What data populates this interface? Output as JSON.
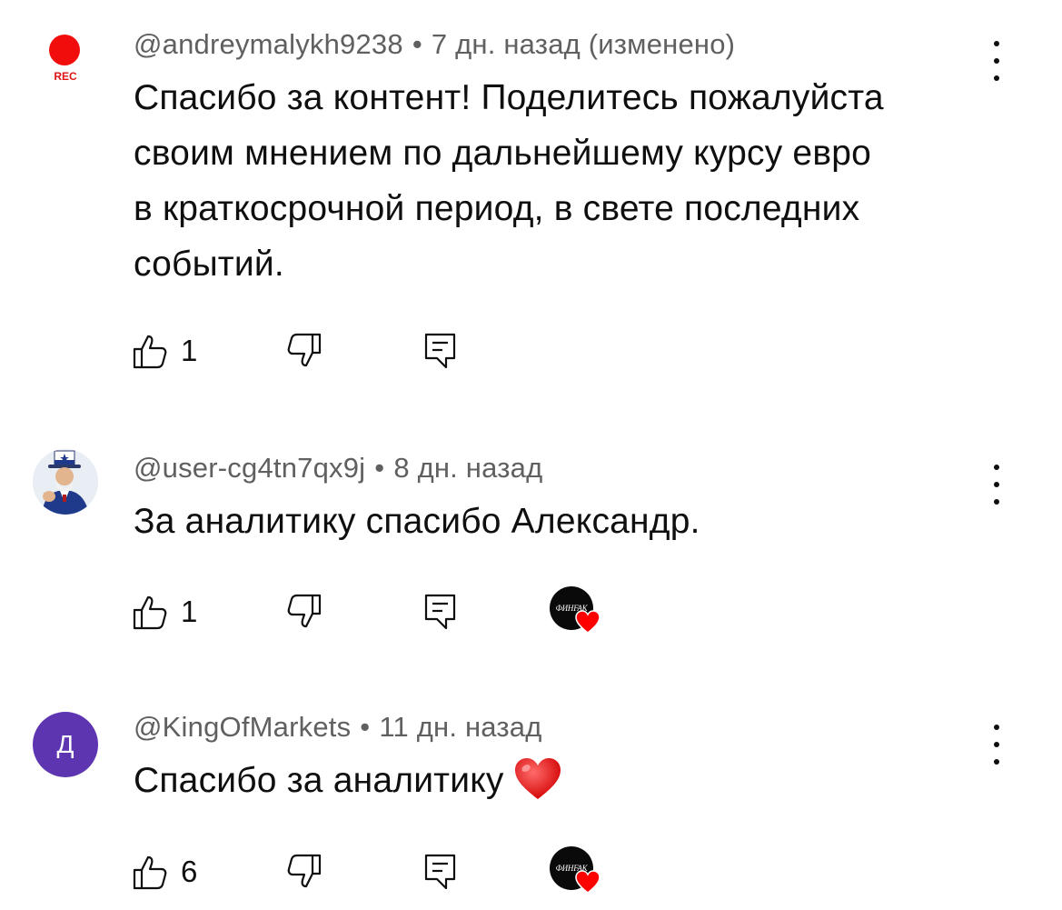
{
  "comments": [
    {
      "author": "@andreymalykh9238",
      "time": "7 дн. назад (изменено)",
      "avatar": {
        "type": "rec",
        "label": "REC",
        "color": "#f20d0d"
      },
      "text_lines": [
        "Спасибо за контент! Поделитесь пожалуйста",
        "своим мнением по дальнейшему курсу евро",
        "в краткосрочной период, в свете последних",
        "событий."
      ],
      "likes": "1",
      "creator_hearted": false
    },
    {
      "author": "@user-cg4tn7qx9j",
      "time": "8 дн. назад",
      "avatar": {
        "type": "image",
        "icon": "uncle-sam-avatar"
      },
      "text_lines": [
        "За аналитику спасибо Александр."
      ],
      "likes": "1",
      "creator_hearted": true
    },
    {
      "author": "@KingOfMarkets",
      "time": "11 дн. назад",
      "avatar": {
        "type": "letter",
        "letter": "Д",
        "color": "#5e35b1"
      },
      "text_lines": [
        "Спасибо за аналитику"
      ],
      "text_emoji": "red-heart-emoji",
      "likes": "6",
      "creator_hearted": true
    }
  ],
  "creator": {
    "label": "ФИНFAK",
    "heart_color": "#ff0000"
  },
  "icons": {
    "like": "thumbs-up-icon",
    "dislike": "thumbs-down-icon",
    "reply": "reply-icon",
    "more": "more-vertical-icon"
  }
}
